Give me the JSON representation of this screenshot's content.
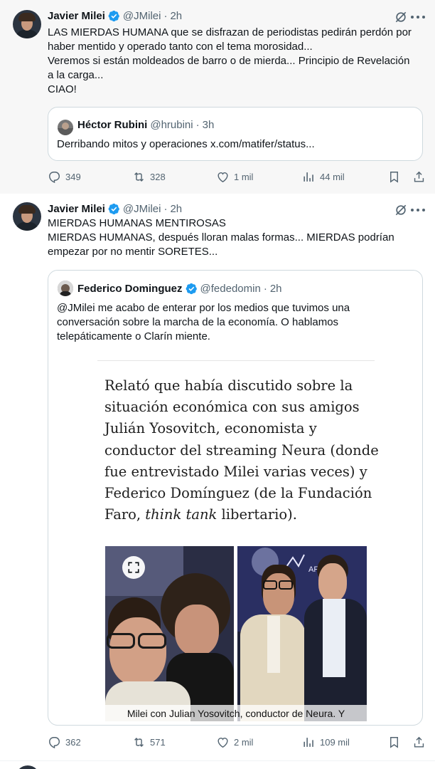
{
  "tweets": [
    {
      "author_name": "Javier Milei",
      "handle": "@JMilei",
      "dot": "·",
      "time": "2h",
      "text_lines": [
        "LAS MIERDAS HUMANA que se disfrazan de periodistas pedirán perdón por",
        "haber mentido y operado tanto con el tema morosidad...",
        "Veremos si están moldeados de barro o de mierda... Principio de Revelación",
        "a la carga...",
        "CIAO!"
      ],
      "quote": {
        "author_name": "Héctor Rubini",
        "handle": "@hrubini",
        "dot": "·",
        "time": "3h",
        "text_lines": [
          "Derribando mitos y operaciones x.com/matifer/status..."
        ]
      },
      "stats": {
        "replies": "349",
        "reposts": "328",
        "likes": "1 mil",
        "views": "44 mil"
      }
    },
    {
      "author_name": "Javier Milei",
      "handle": "@JMilei",
      "dot": "·",
      "time": "2h",
      "text_lines": [
        "MIERDAS HUMANAS MENTIROSAS",
        "MIERDAS HUMANAS, después lloran malas formas... MIERDAS podrían",
        "empezar por no mentir SORETES..."
      ],
      "quote": {
        "author_name": "Federico Dominguez",
        "handle": "@fededomin",
        "dot": "·",
        "time": "2h",
        "text_lines": [
          "@JMilei me acabo de enterar por los medios que tuvimos una",
          "conversación sobre la marcha de la economía. O hablamos",
          "telepáticamente o Clarín miente."
        ],
        "article": {
          "lines": [
            "Relató que había discutido sobre la",
            "situación económica con sus amigos",
            "Julián Yosovitch, economista y",
            "conductor del streaming Neura (donde",
            "fue entrevistado Milei varias veces) y",
            "Federico Domínguez (de la Fundación"
          ],
          "last_line_prefix": "Faro, ",
          "last_line_italic": "think tank",
          "last_line_suffix": " libertario).",
          "photo_sign": "AFTER MA",
          "caption": "Milei con Julian Yosovitch, conductor de Neura. Y"
        }
      },
      "stats": {
        "replies": "362",
        "reposts": "571",
        "likes": "2 mil",
        "views": "109 mil"
      }
    }
  ],
  "icons": {
    "verified": "verified-badge-icon",
    "grok": "grok-icon",
    "more": "more-icon",
    "reply": "reply-icon",
    "repost": "repost-icon",
    "like": "like-icon",
    "views": "views-icon",
    "bookmark": "bookmark-icon",
    "share": "share-icon",
    "expand": "expand-icon"
  },
  "colors": {
    "verified_blue": "#1d9bf0",
    "secondary_text": "#536471",
    "border": "#cfd9de"
  }
}
